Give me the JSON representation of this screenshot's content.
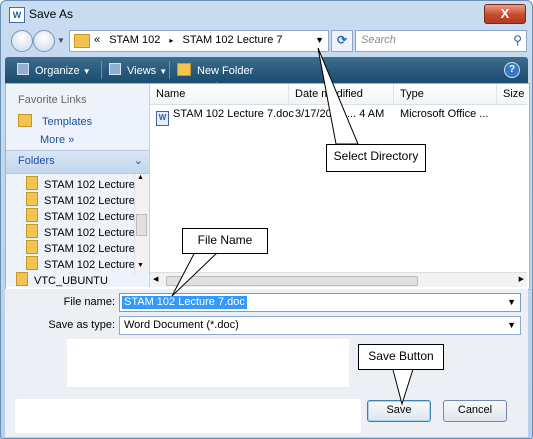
{
  "window": {
    "title": "Save As",
    "close_label": "X"
  },
  "address": {
    "prefix": "«",
    "crumb1": "STAM 102",
    "separator": "▸",
    "crumb2": "STAM 102 Lecture 7",
    "search_placeholder": "Search"
  },
  "toolbar": {
    "organize_label": "Organize",
    "views_label": "Views",
    "new_folder_label": "New Folder",
    "help_label": "?"
  },
  "nav": {
    "favorite_links_title": "Favorite Links",
    "favorites": [
      {
        "label": "Templates"
      },
      {
        "label": "More  »"
      }
    ],
    "folders_title": "Folders",
    "tree": [
      {
        "label": "STAM 102 Lecture"
      },
      {
        "label": "STAM 102 Lecture"
      },
      {
        "label": "STAM 102 Lecture"
      },
      {
        "label": "STAM 102 Lecture"
      },
      {
        "label": "STAM 102 Lecture"
      },
      {
        "label": "STAM 102 Lecture"
      },
      {
        "label": "VTC_UBUNTU"
      }
    ]
  },
  "list": {
    "columns": [
      "Name",
      "Date modified",
      "Type",
      "Size"
    ],
    "rows": [
      {
        "name": "STAM 102 Lecture 7.doc",
        "date": "3/17/2010 ... 4 AM",
        "type": "Microsoft Office ..."
      }
    ]
  },
  "form": {
    "file_name_label": "File name:",
    "file_name_value": "STAM 102 Lecture 7.doc",
    "save_as_type_label": "Save as type:",
    "save_as_type_value": "Word Document (*.doc)"
  },
  "buttons": {
    "save_label": "Save",
    "cancel_label": "Cancel"
  },
  "callouts": {
    "select_directory": "Select Directory",
    "file_name": "File Name",
    "save_button": "Save Button"
  },
  "colors": {
    "toolbar": "#28587b",
    "selection": "#3399ff",
    "link": "#1c4fa0"
  }
}
